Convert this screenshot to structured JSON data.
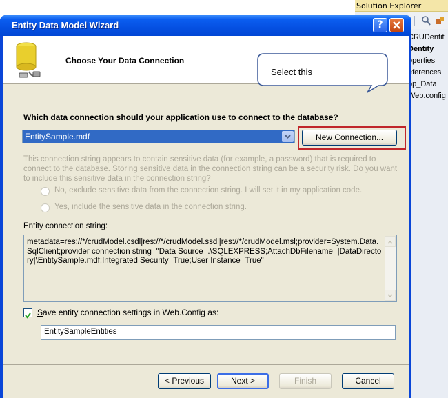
{
  "solution_explorer": {
    "title": "Solution Explorer",
    "items": [
      "CRUDentit",
      "Dentity",
      "operties",
      "eferences",
      "pp_Data",
      "Web.config"
    ]
  },
  "wizard": {
    "title": "Entity Data Model Wizard",
    "header_title": "Choose Your Data Connection",
    "question_prefix": "",
    "question_underlined": "W",
    "question_rest": "hich data connection should your application use to connect to the database?",
    "connection_value": "EntitySample.mdf",
    "new_connection": {
      "underlined_prefix": "New ",
      "underlined": "C",
      "rest": "onnection..."
    },
    "sensitive_text": "This connection string appears to contain sensitive data (for example, a password) that is required to connect to the database. Storing sensitive data in the connection string can be a security risk. Do you want to include this sensitive data in the connection string?",
    "radio_no": "No, exclude sensitive data from the connection string. I will set it in my application code.",
    "radio_yes": "Yes, include the sensitive data in the connection string.",
    "ecs_label": "Entity connection string:",
    "ecs_value": "metadata=res://*/crudModel.csdl|res://*/crudModel.ssdl|res://*/crudModel.msl;provider=System.Data.SqlClient;provider connection string=\"Data Source=.\\SQLEXPRESS;AttachDbFilename=|DataDirectory|\\EntitySample.mdf;Integrated Security=True;User Instance=True\"",
    "save_checked": true,
    "save_label_u": "S",
    "save_label_rest": "ave entity connection settings in Web.Config as:",
    "entities_name": "EntitySampleEntities",
    "buttons": {
      "previous": "< Previous",
      "next": "Next >",
      "finish": "Finish",
      "cancel": "Cancel"
    }
  },
  "callout": {
    "text": "Select this"
  }
}
